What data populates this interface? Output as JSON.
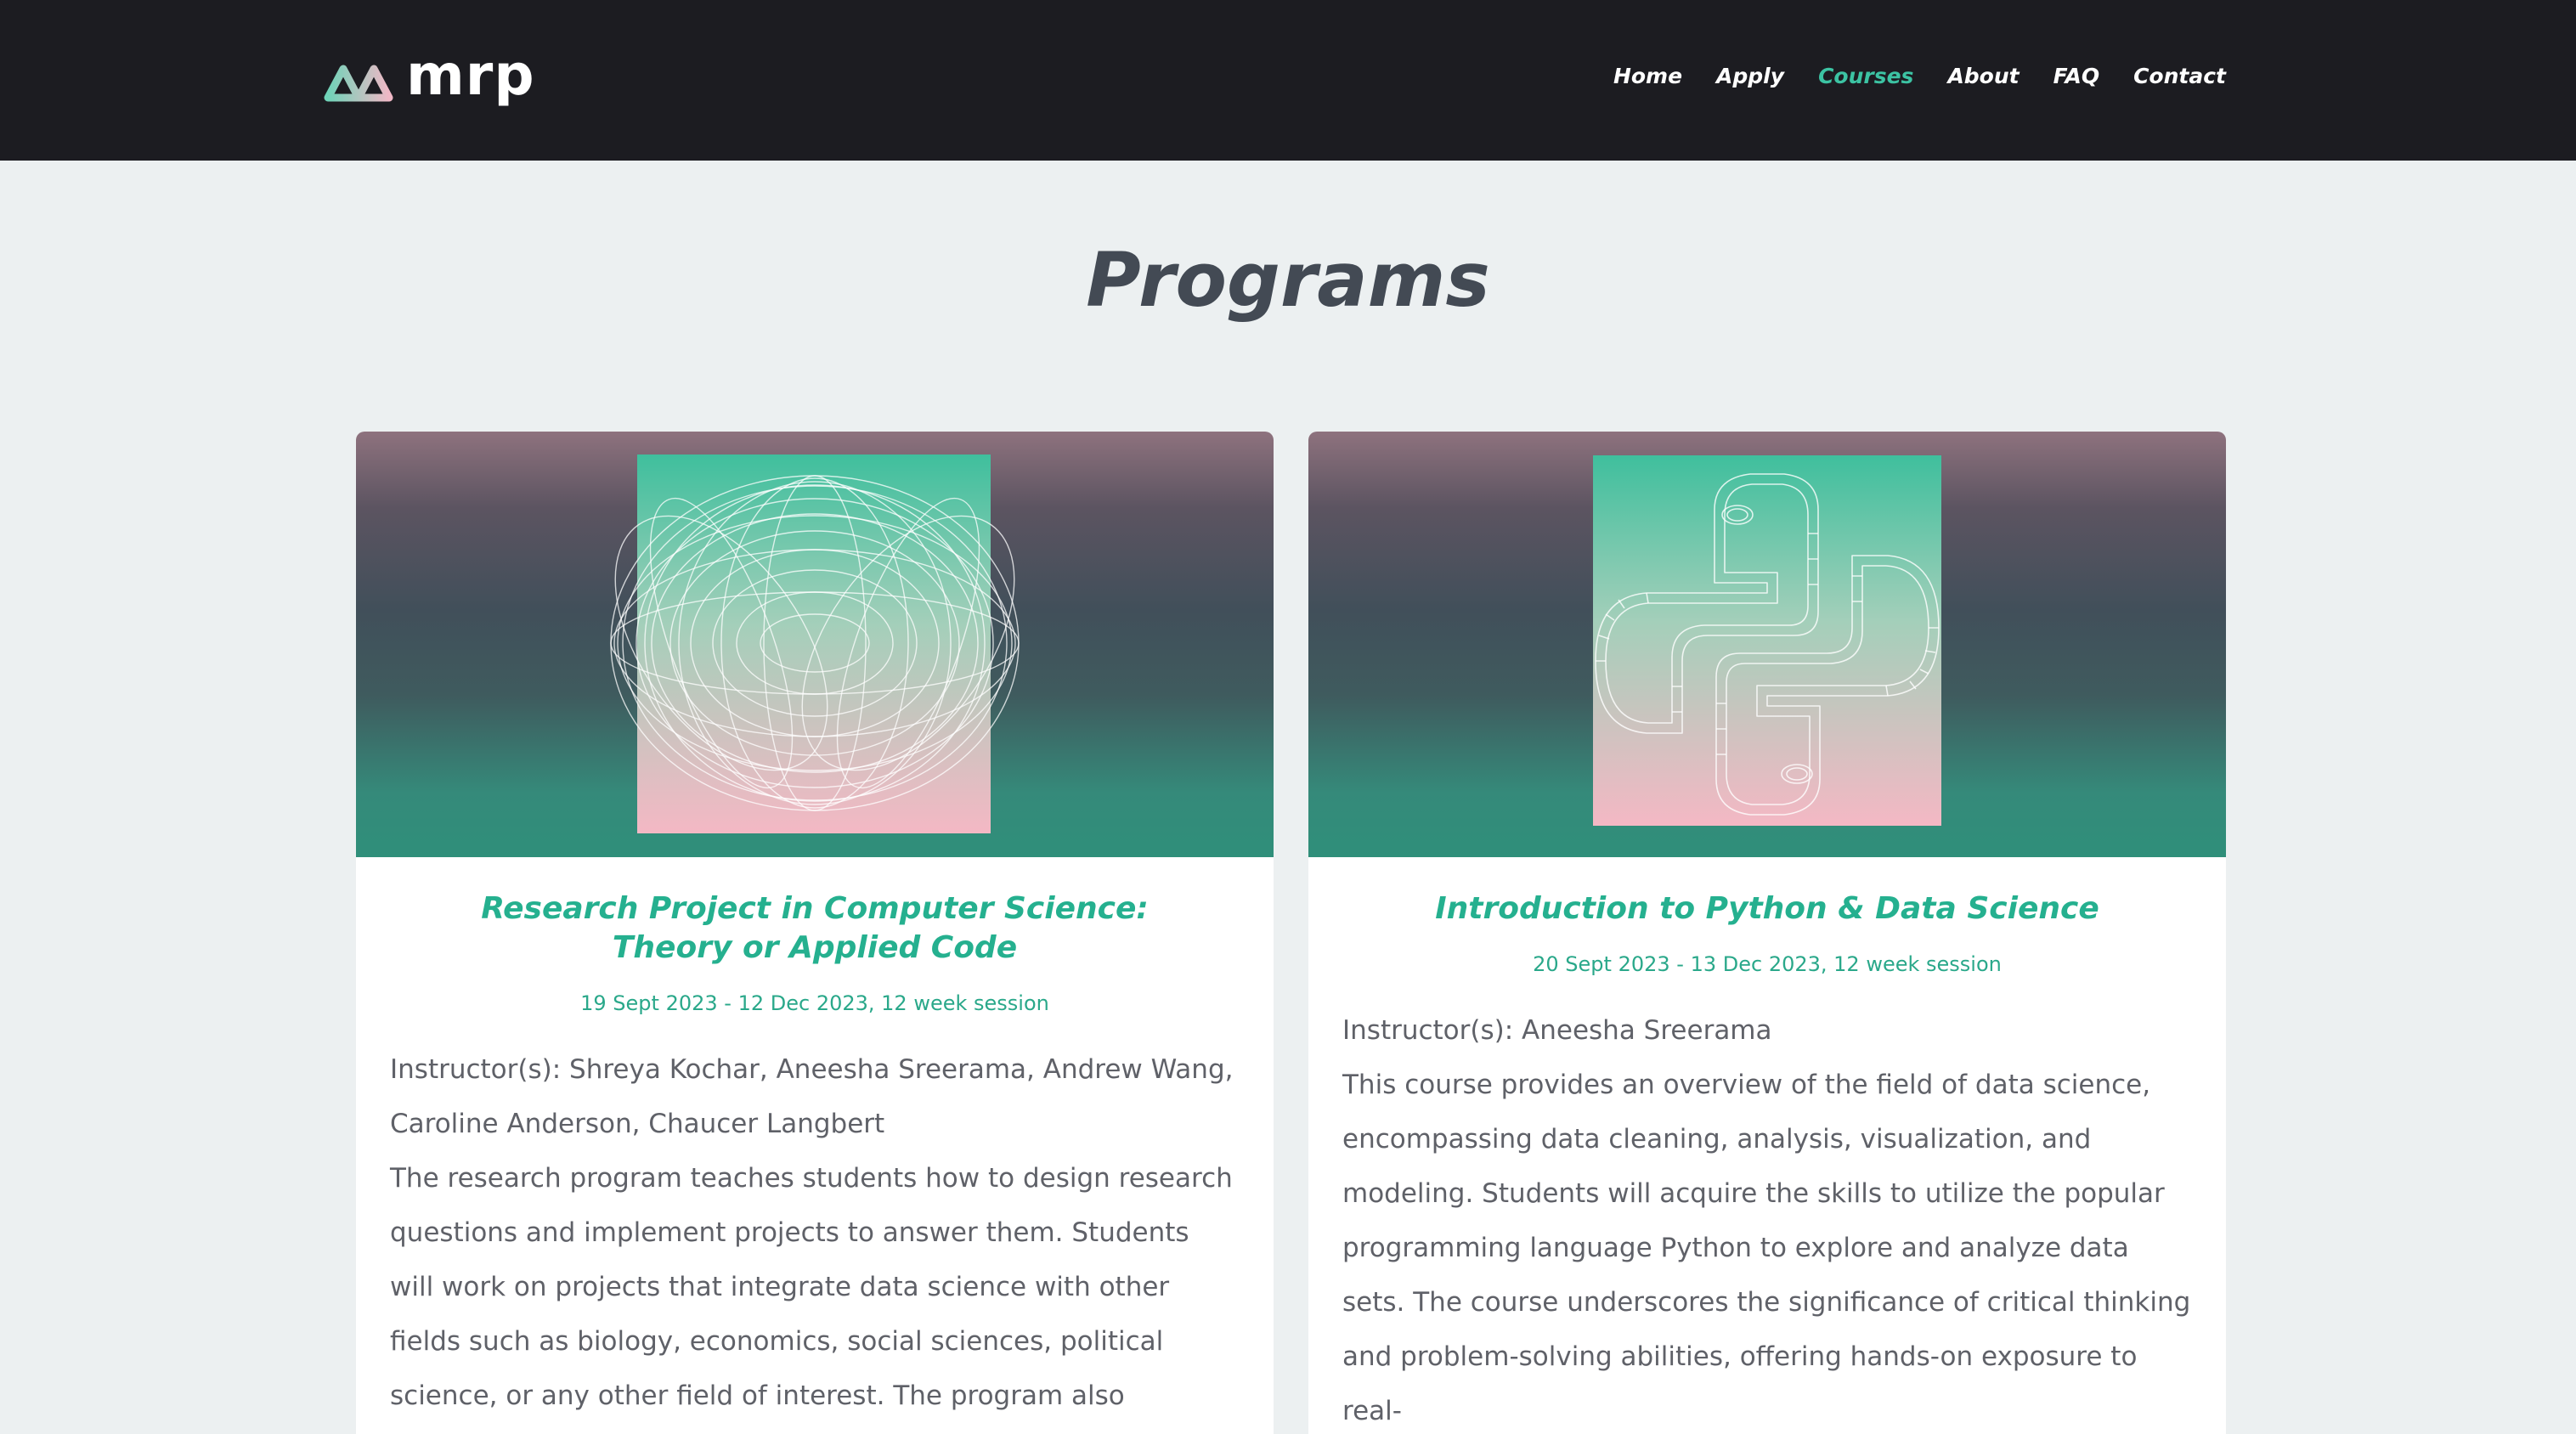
{
  "header": {
    "logo_text": "mrp",
    "nav": [
      {
        "label": "Home",
        "active": false
      },
      {
        "label": "Apply",
        "active": false
      },
      {
        "label": "Courses",
        "active": true
      },
      {
        "label": "About",
        "active": false
      },
      {
        "label": "FAQ",
        "active": false
      },
      {
        "label": "Contact",
        "active": false
      }
    ]
  },
  "page": {
    "title": "Programs"
  },
  "courses": [
    {
      "title": "Research Project in Computer Science: Theory or Applied Code",
      "dates": "19 Sept 2023 - 12 Dec 2023, 12 week session",
      "instructors": "Instructor(s): Shreya Kochar, Aneesha Sreerama, Andrew Wang, Caroline Anderson, Chaucer Langbert",
      "description": "The research program teaches students how to design research questions and implement projects to answer them. Students will work on projects that integrate data science with other fields such as biology, economics, social sciences, political science, or any other field of interest. The program also includes college",
      "image_icon": "torus-wireframe-icon"
    },
    {
      "title": "Introduction to Python & Data Science",
      "dates": "20 Sept 2023 - 13 Dec 2023, 12 week session",
      "instructors": "Instructor(s): Aneesha Sreerama",
      "description": "This course provides an overview of the field of data science, encompassing data cleaning, analysis, visualization, and modeling. Students will acquire the skills to utilize the popular programming language Python to explore and analyze data sets. The course underscores the significance of critical thinking and problem-solving abilities, offering hands-on exposure to real-",
      "image_icon": "python-logo-wireframe-icon"
    }
  ],
  "colors": {
    "header_bg": "#1c1c21",
    "page_bg": "#ecf0f1",
    "accent": "#3cc3a3",
    "title_text": "#434a54",
    "body_text": "#5f6168"
  }
}
